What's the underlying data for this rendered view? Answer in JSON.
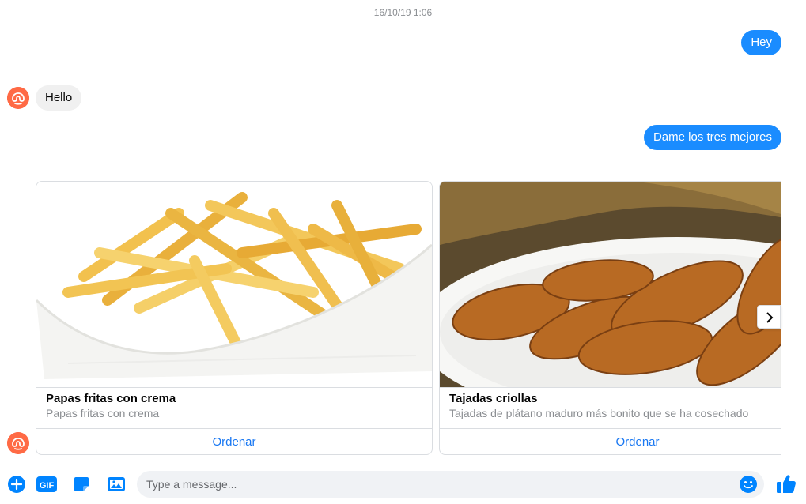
{
  "timestamp": "16/10/19 1:06",
  "messages": {
    "out1": "Hey",
    "in1": "Hello",
    "out2": "Dame los tres mejores"
  },
  "cards": [
    {
      "title": "Papas fritas con crema",
      "subtitle": "Papas fritas con crema",
      "button": "Ordenar"
    },
    {
      "title": "Tajadas criollas",
      "subtitle": "Tajadas de plátano maduro más bonito que se ha cosechado",
      "button": "Ordenar"
    }
  ],
  "composer": {
    "placeholder": "Type a message..."
  },
  "colors": {
    "accent": "#1a8cff",
    "avatar": "#ff6a45",
    "link": "#1877f2"
  },
  "icons": [
    "plus-icon",
    "gif-icon",
    "sticker-icon",
    "image-icon",
    "emoji-icon",
    "thumbs-up-icon",
    "chevron-right-icon"
  ]
}
